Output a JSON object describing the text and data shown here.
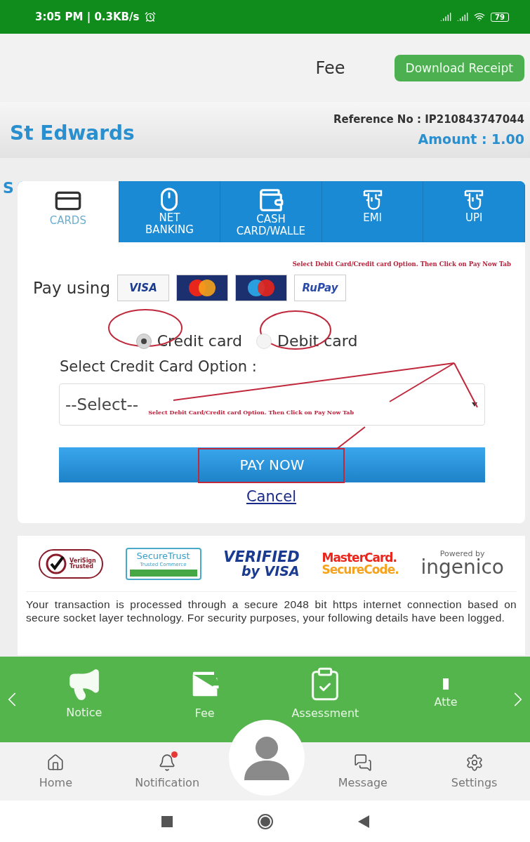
{
  "status_bar": {
    "time": "3:05 PM | 0.3KB/s",
    "battery": "79"
  },
  "header": {
    "title": "Fee",
    "button": "Download Receipt"
  },
  "school": {
    "hidden_heading": "S",
    "name": "St Edwards",
    "reference": "Reference No : IP210843747044",
    "amount": "Amount : 1.00"
  },
  "payment_tabs": [
    {
      "label": "CARDS",
      "selected": true
    },
    {
      "label": "NET\nBANKING",
      "selected": false
    },
    {
      "label": "CASH\nCARD/WALLE",
      "selected": false
    },
    {
      "label": "EMI",
      "selected": false
    },
    {
      "label": "UPI",
      "selected": false
    }
  ],
  "note": "Select Debit Card/Credit card Option. Then Click on Pay Now Tab",
  "pay_using": {
    "label": "Pay using",
    "brands": [
      {
        "kind": "visa",
        "text": "VISA"
      },
      {
        "kind": "mastercard"
      },
      {
        "kind": "maestro"
      },
      {
        "kind": "rupay",
        "text": "RuPay"
      }
    ]
  },
  "card_types": [
    {
      "label": "Credit card",
      "selected": true
    },
    {
      "label": "Debit card",
      "selected": false
    }
  ],
  "option_label": "Select Credit Card Option :",
  "select": {
    "value": "--Select--",
    "note": "Select Debit Card/Credit card Option. Then Click on Pay Now Tab"
  },
  "pay_button": "PAY NOW",
  "cancel": "Cancel",
  "trust_logos": [
    {
      "kind": "verisign",
      "lines": [
        "VeriSign",
        "Trusted"
      ]
    },
    {
      "kind": "securetrust",
      "lines": [
        "SecureTrust",
        "Trusted Commerce"
      ]
    },
    {
      "kind": "vbv",
      "lines": [
        "VERIFIED",
        "by VISA"
      ]
    },
    {
      "kind": "mcsc",
      "lines": [
        "MasterCard.",
        "SecureCode."
      ]
    },
    {
      "kind": "ingenico",
      "lines": [
        "Powered by",
        "ingenico"
      ]
    }
  ],
  "security_text": "Your transaction is processed through a secure 2048 bit https internet connection based on secure socket layer technology. For security purposes, your following details have been logged.",
  "feature_nav": [
    {
      "label": "Notice"
    },
    {
      "label": "Fee"
    },
    {
      "label": "Assessment"
    },
    {
      "label": "Atte"
    }
  ],
  "bottom_nav": [
    {
      "label": "Home",
      "badge": false
    },
    {
      "label": "Notification",
      "badge": true
    },
    {
      "label": "Message",
      "badge": false
    },
    {
      "label": "Settings",
      "badge": false
    }
  ]
}
